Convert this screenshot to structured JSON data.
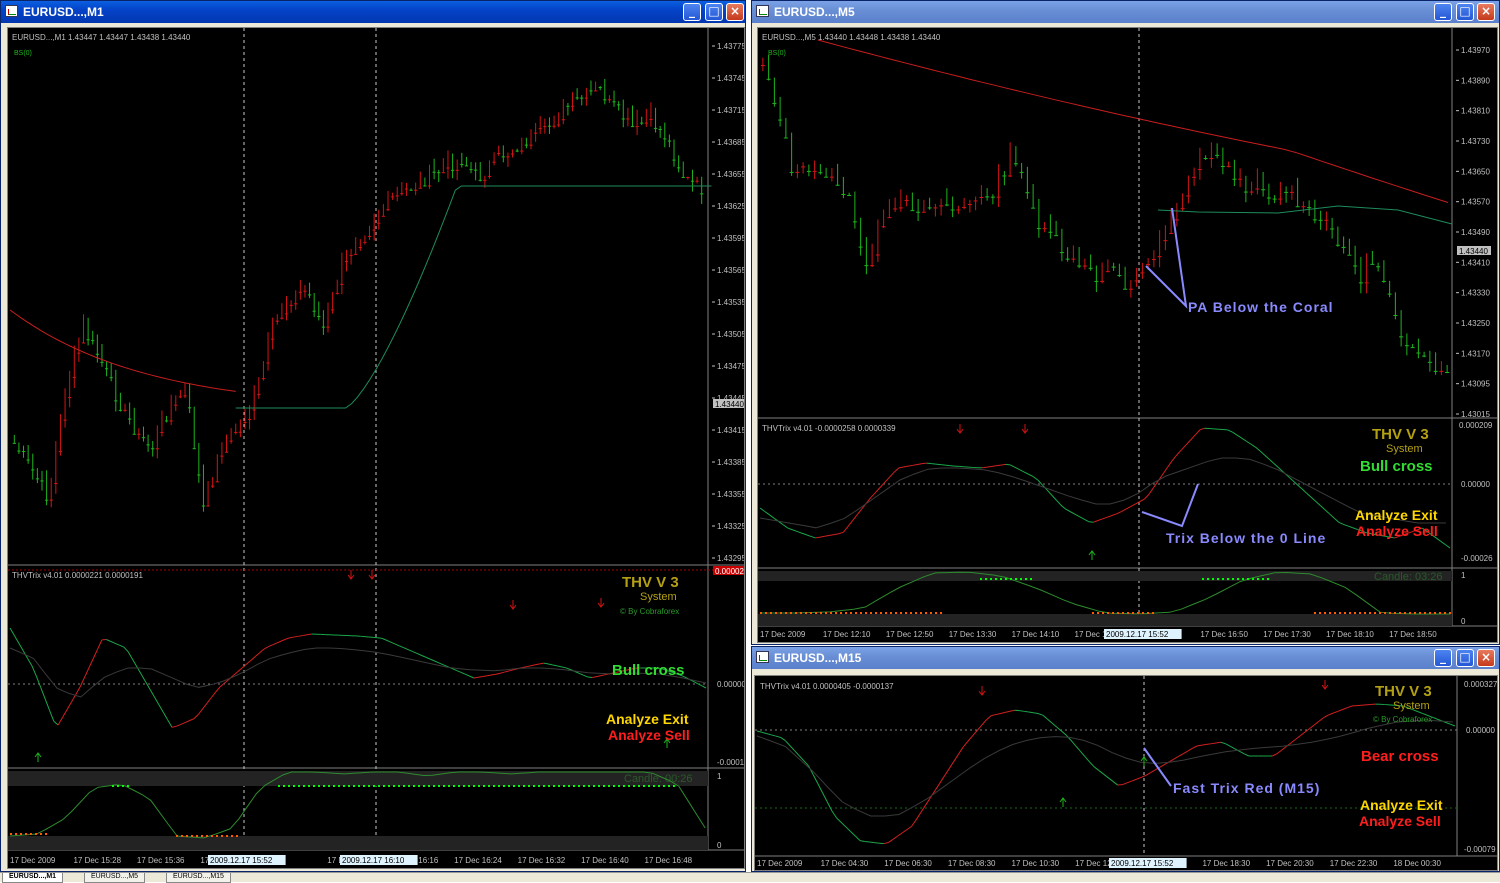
{
  "windows": [
    {
      "title": "EURUSD...,M1",
      "info": "EURUSD...,M1  1.43447 1.43447 1.43438 1.43440",
      "bs": "BS(0)",
      "price_axis": [
        "1.43775",
        "1.43745",
        "1.43715",
        "1.43685",
        "1.43655",
        "1.43625",
        "1.43595",
        "1.43565",
        "1.43535",
        "1.43505",
        "1.43475",
        "1.43445",
        "1.43415",
        "1.43385",
        "1.43355",
        "1.43325",
        "1.43295"
      ],
      "current_price": "1.43440",
      "trix_info": "THVTrix v4.01 0.0000221 0.0000191",
      "trix_axis": [
        "0.000026",
        "0.00000",
        "-0.00014"
      ],
      "thv": {
        "title": "THV V 3",
        "system": "System",
        "by": "© By Cobraforex",
        "cross": "Bull cross",
        "exit": "Analyze Exit",
        "sell": "Analyze Sell"
      },
      "lag_info": "Laguerre RSI 219 (0.70) 1.0000 0.8000",
      "candle": "Candle:  00:26",
      "lag_axis": [
        "1",
        "0"
      ],
      "time_axis": [
        "17 Dec 2009",
        "17 Dec 15:28",
        "17 Dec 15:36",
        "17 De",
        "52",
        "17 Dec 16",
        "17 Dec 16:16",
        "17 Dec 16:24",
        "17 Dec 16:32",
        "17 Dec 16:40",
        "17 Dec 16:48"
      ],
      "time_markers": [
        "2009.12.17 15:52",
        "2009.12.17 16:10"
      ]
    },
    {
      "title": "EURUSD...,M5",
      "info": "EURUSD...,M5  1.43440 1.43448 1.43438 1.43440",
      "bs": "BS(0)",
      "price_axis": [
        "1.43970",
        "1.43890",
        "1.43810",
        "1.43730",
        "1.43650",
        "1.43570",
        "1.43490",
        "1.43410",
        "1.43330",
        "1.43250",
        "1.43170",
        "1.43095",
        "1.43015"
      ],
      "current_price": "1.43440",
      "trix_info": "THVTrix v4.01 -0.0000258 0.0000339",
      "trix_axis": [
        "0.000209",
        "0.00000",
        "-0.00026"
      ],
      "thv": {
        "title": "THV V 3",
        "system": "System",
        "cross": "Bull cross",
        "exit": "Analyze Exit",
        "sell": "Analyze Sell"
      },
      "lag_info": "Laguerre RSI 80 (0.70) 0.4817",
      "candle": "Candle:  03:26",
      "lag_axis": [
        "1",
        "0"
      ],
      "time_axis": [
        "17 Dec 2009",
        "17 Dec 12:10",
        "17 Dec 12:50",
        "17 Dec 13:30",
        "17 Dec 14:10",
        "17 Dec 14:50",
        "Dec 16:10",
        "17 Dec 16:50",
        "17 Dec 17:30",
        "17 Dec 18:10",
        "17 Dec 18:50"
      ],
      "time_markers": [
        "2009.12.17 15:52"
      ],
      "annotations": [
        "PA Below the Coral",
        "Trix Below the 0 Line"
      ]
    },
    {
      "title": "EURUSD...,M15",
      "trix_info": "THVTrix v4.01 0.0000405 -0.0000137",
      "trix_axis": [
        "0.000327",
        "0.00000",
        "-0.00079"
      ],
      "thv": {
        "title": "THV V 3",
        "system": "System",
        "by": "© By Cobraforex",
        "cross": "Bear cross",
        "exit": "Analyze Exit",
        "sell": "Analyze Sell"
      },
      "time_axis": [
        "17 Dec 2009",
        "17 Dec 04:30",
        "17 Dec 06:30",
        "17 Dec 08:30",
        "17 Dec 10:30",
        "17 Dec 12:30",
        "Dec 16:30",
        "17 Dec 18:30",
        "17 Dec 20:30",
        "17 Dec 22:30",
        "18 Dec 00:30"
      ],
      "time_markers": [
        "2009.12.17 15:52"
      ],
      "annotations": [
        "Fast Trix Red (M15)"
      ]
    }
  ],
  "tabs": [
    "EURUSD...,M1",
    "EURUSD...,M5",
    "EURUSD...,M15"
  ],
  "colors": {
    "bull": "#1db41d",
    "bear": "#d21414",
    "coral": "#c81e1e",
    "thv_gold": "#b4a014",
    "bull_cross": "#32dc32",
    "exit": "#ffd700",
    "sell": "#ff1e1e",
    "annotation": "#8a8aff",
    "dot_green": "#00ff00",
    "dot_orange": "#ff5a00"
  }
}
